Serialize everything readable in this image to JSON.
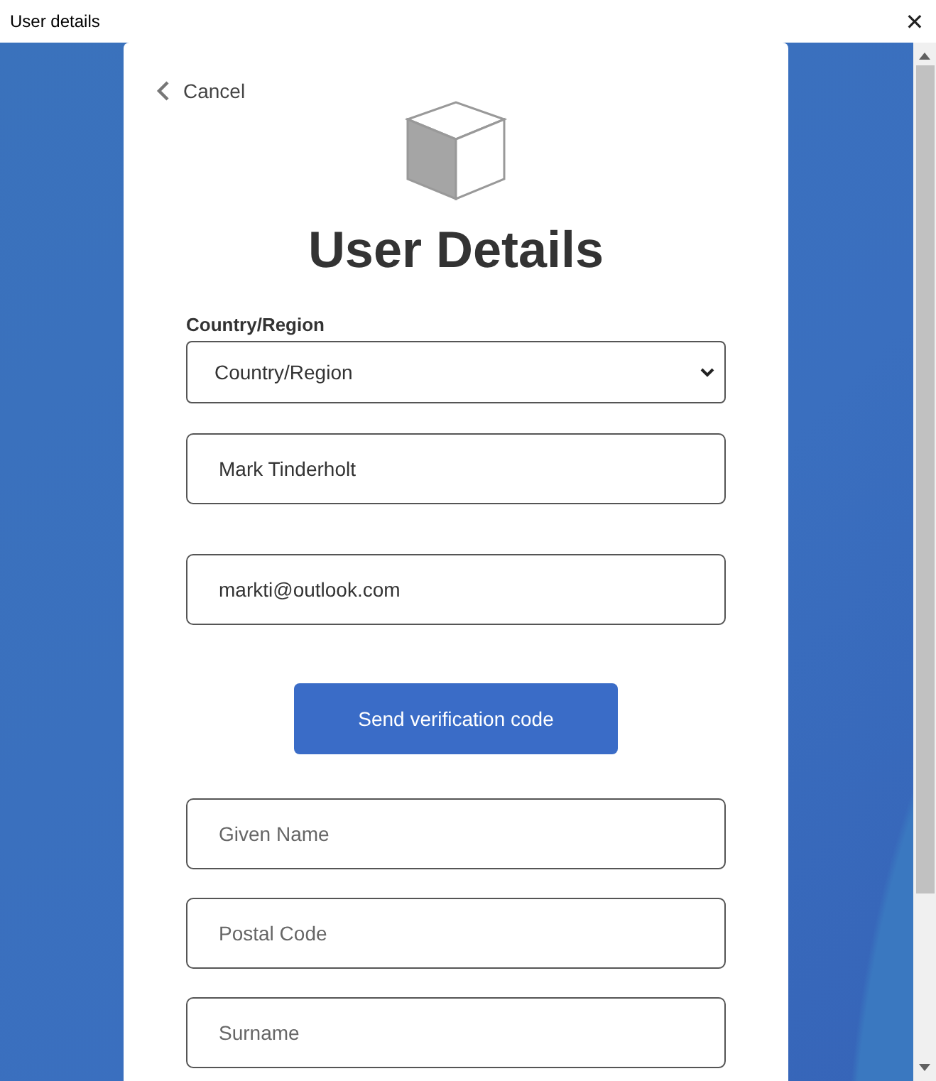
{
  "window": {
    "title": "User details",
    "close": "✕"
  },
  "cancel": {
    "label": "Cancel"
  },
  "heading": "User Details",
  "country": {
    "label": "Country/Region",
    "value": "Country/Region"
  },
  "fields": [
    {
      "kind": "value",
      "text": "Mark Tinderholt"
    },
    {
      "kind": "value",
      "text": "markti@outlook.com"
    },
    {
      "kind": "button",
      "text": "Send verification code"
    },
    {
      "kind": "placeholder",
      "placeholder": "Given Name"
    },
    {
      "kind": "placeholder",
      "placeholder": "Postal Code"
    },
    {
      "kind": "placeholder",
      "placeholder": "Surname"
    }
  ]
}
